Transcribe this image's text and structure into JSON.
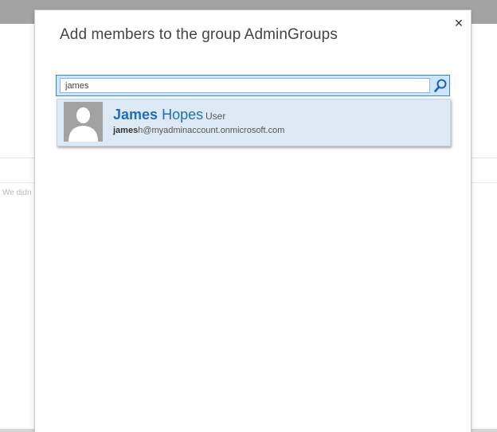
{
  "background": {
    "partial_text": "We didn"
  },
  "dialog": {
    "title": "Add members to the group AdminGroups",
    "close_glyph": "×",
    "search": {
      "value": "james",
      "icon": "search-icon"
    },
    "suggestion": {
      "name_match": "James",
      "name_rest": " Hopes",
      "type": "User",
      "email_match": "james",
      "email_rest": "h@myadminaccount.onmicrosoft.com",
      "avatar_icon": "person-silhouette-icon"
    }
  },
  "colors": {
    "accent": "#1f6fb8",
    "search_border": "#2a8dd4",
    "suggestion_bg": "#ddeaf6",
    "top_bar": "#a3a3a3"
  }
}
